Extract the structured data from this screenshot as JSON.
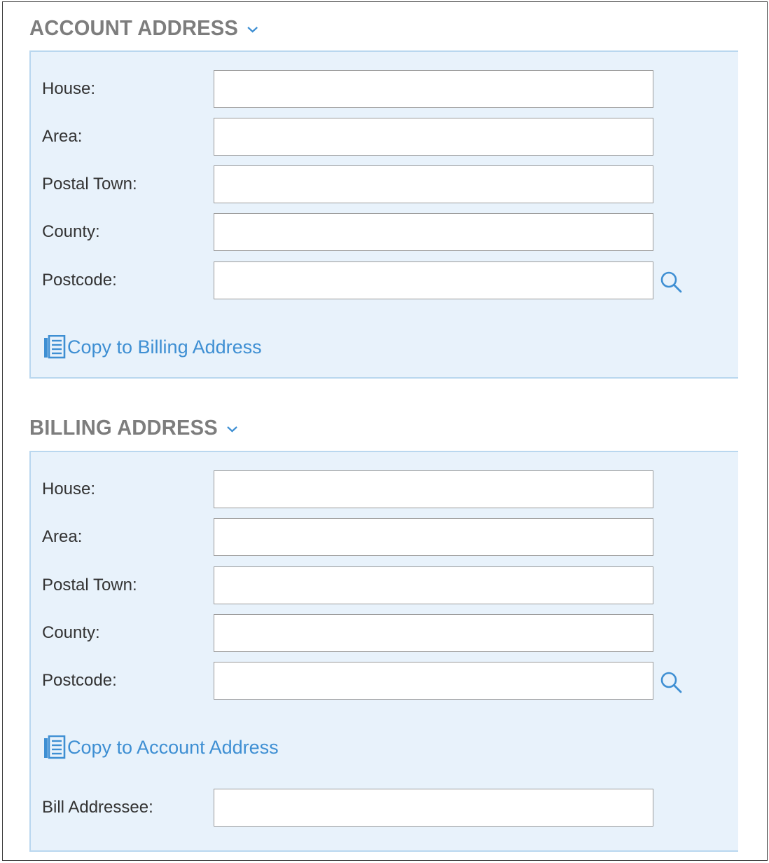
{
  "account": {
    "title": "ACCOUNT ADDRESS",
    "fields": [
      {
        "label": "House:",
        "value": ""
      },
      {
        "label": "Area:",
        "value": ""
      },
      {
        "label": "Postal Town:",
        "value": ""
      },
      {
        "label": "County:",
        "value": ""
      },
      {
        "label": "Postcode:",
        "value": ""
      }
    ],
    "copy_label": "Copy to Billing Address"
  },
  "billing": {
    "title": "BILLING ADDRESS",
    "fields": [
      {
        "label": "House:",
        "value": ""
      },
      {
        "label": "Area:",
        "value": ""
      },
      {
        "label": "Postal Town:",
        "value": ""
      },
      {
        "label": "County:",
        "value": ""
      },
      {
        "label": "Postcode:",
        "value": ""
      }
    ],
    "copy_label": "Copy to Account Address",
    "addressee": {
      "label": "Bill Addressee:",
      "value": ""
    }
  },
  "icons": {
    "expand": "chevron-down-icon",
    "search": "search-icon",
    "copy": "copy-icon"
  },
  "colors": {
    "accent": "#3e8fd3",
    "panel_bg": "#e8f2fb",
    "panel_border": "#b9d7ef",
    "title": "#7d7d7d"
  }
}
